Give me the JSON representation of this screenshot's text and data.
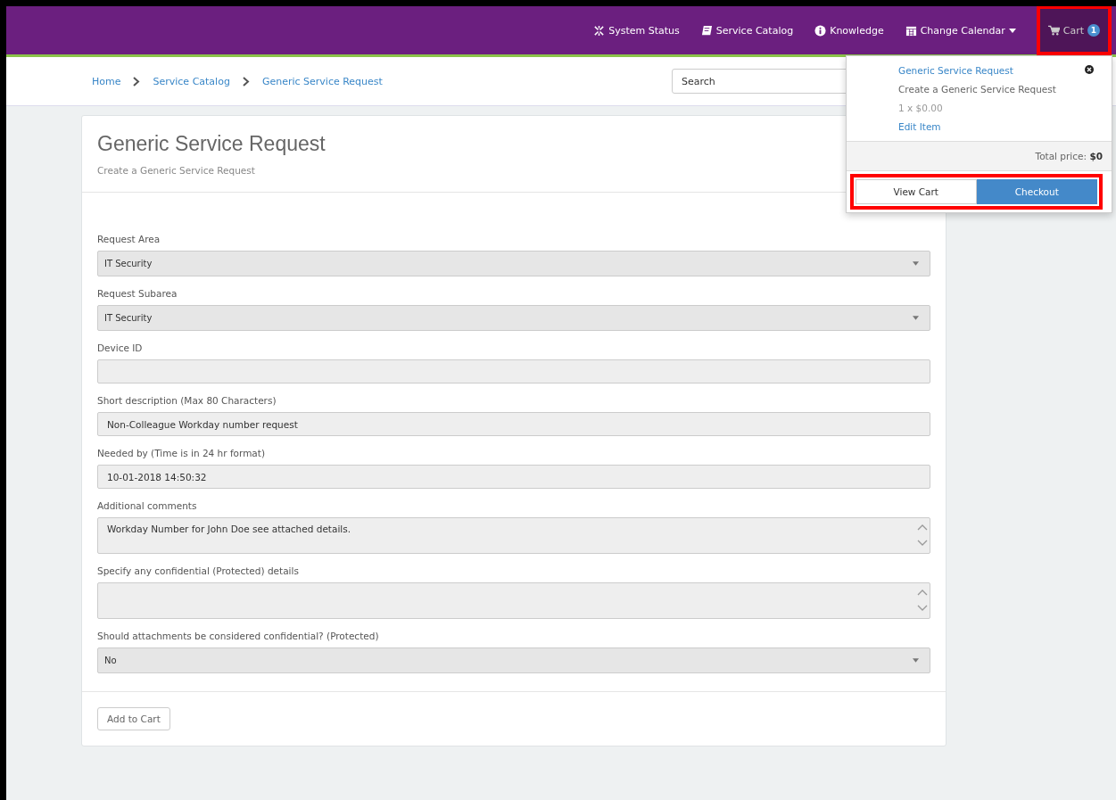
{
  "navbar": {
    "items": [
      {
        "kind": "status",
        "label": "System Status"
      },
      {
        "kind": "book",
        "label": "Service Catalog"
      },
      {
        "kind": "info",
        "label": "Knowledge"
      },
      {
        "kind": "calendar",
        "label": "Change Calendar",
        "dropdown": true
      }
    ],
    "cart": {
      "label": "Cart",
      "count": "1",
      "highlighted": true
    }
  },
  "breadcrumb": [
    "Home",
    "Service Catalog",
    "Generic Service Request"
  ],
  "search": {
    "placeholder": "Search"
  },
  "form": {
    "title": "Generic Service Request",
    "subtitle": "Create a Generic Service Request",
    "fields": [
      {
        "kind": "select",
        "label": "Request Area",
        "value": "IT Security"
      },
      {
        "kind": "select",
        "label": "Request Subarea",
        "value": "IT Security"
      },
      {
        "kind": "input",
        "label": "Device ID"
      },
      {
        "kind": "input",
        "label": "Short description (Max 80 Characters)",
        "value": "Non-Colleague Workday number request"
      },
      {
        "kind": "input",
        "label": "Needed by (Time is in 24 hr format)",
        "value": "10-01-2018 14:50:32"
      },
      {
        "kind": "textarea",
        "label": "Additional comments",
        "value": "Workday Number for John Doe see attached details."
      },
      {
        "kind": "textarea",
        "label": "Specify any confidential (Protected) details"
      },
      {
        "kind": "select",
        "label": "Should attachments be considered confidential? (Protected)",
        "value": "No"
      }
    ],
    "button": "Add to Cart"
  },
  "cart_dropdown": {
    "item_title": "Generic Service Request",
    "item_description": "Create a Generic Service Request",
    "item_price": "1 x $0.00",
    "edit_link": "Edit Item",
    "total_label": "Total price:",
    "total_value": "$0",
    "view_button": "View Cart",
    "checkout_button": "Checkout",
    "actions_highlighted": true
  }
}
